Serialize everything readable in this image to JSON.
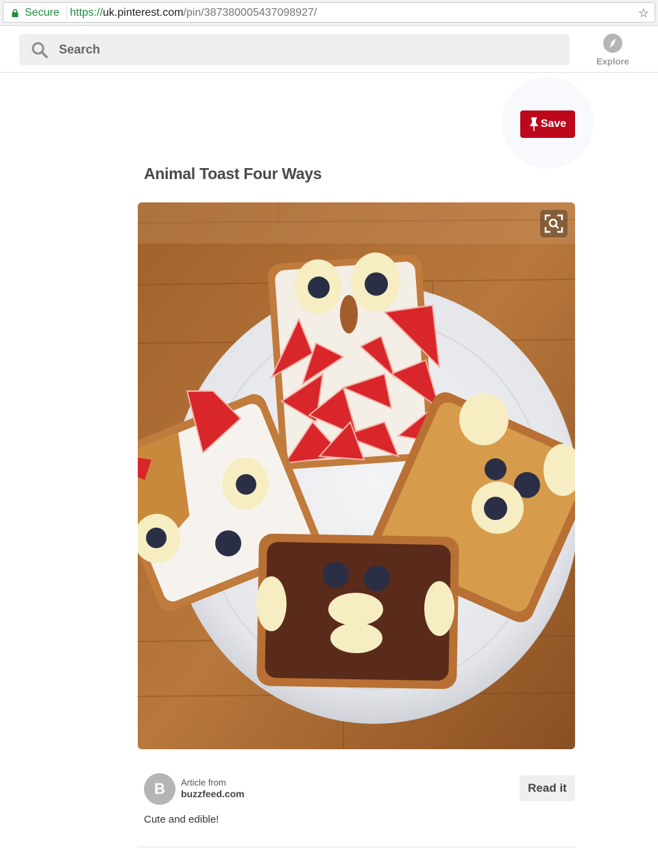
{
  "browser": {
    "secure_label": "Secure",
    "url_scheme": "https://",
    "url_host": "uk.pinterest.com",
    "url_path": "/pin/387380005437098927/",
    "bookmark_icon": "star-icon"
  },
  "header": {
    "search_placeholder": "Search",
    "explore_label": "Explore"
  },
  "pin": {
    "save_label": "Save",
    "title": "Animal Toast Four Ways",
    "source": {
      "avatar_letter": "B",
      "article_from_label": "Article from",
      "domain": "buzzfeed.com"
    },
    "read_it_label": "Read it",
    "description": "Cute and edible!"
  },
  "colors": {
    "save_red": "#bd081c",
    "secure_green": "#1e8e3e"
  }
}
